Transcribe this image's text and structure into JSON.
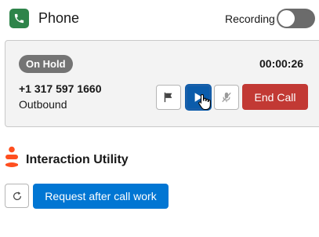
{
  "header": {
    "title": "Phone",
    "phone_icon": "phone-icon",
    "recording_label": "Recording",
    "recording_on": false
  },
  "call": {
    "status_badge": "On Hold",
    "timer": "00:00:26",
    "number": "+1 317 597 1660",
    "direction": "Outbound",
    "buttons": {
      "flag_icon": "flag-icon",
      "play_icon": "play-icon",
      "mute_icon": "mute-microphone-icon",
      "end_call_label": "End Call"
    }
  },
  "utility": {
    "logo_icon": "genesys-logo-icon",
    "title": "Interaction Utility",
    "refresh_icon": "refresh-icon",
    "request_acw_label": "Request after call work"
  },
  "colors": {
    "phone_green": "#2e844a",
    "end_call_red": "#c23934",
    "brand_blue": "#0176d3",
    "logo_orange": "#ff4f1f"
  }
}
